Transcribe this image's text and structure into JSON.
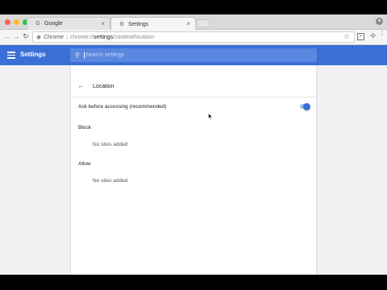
{
  "colors": {
    "accent": "#3b6fd6",
    "traffic_red": "#fc5f57",
    "traffic_yellow": "#fdbc2e",
    "traffic_green": "#28c840"
  },
  "tabs": [
    {
      "label": "Google",
      "icon": "google-favicon",
      "active": false
    },
    {
      "label": "Settings",
      "icon": "gear-icon",
      "active": true
    }
  ],
  "omnibox": {
    "site_label": "Chrome",
    "url_scheme": "chrome://",
    "url_host": "settings",
    "url_path": "/content/location"
  },
  "header": {
    "title": "Settings",
    "search_placeholder": "Search settings"
  },
  "page": {
    "title": "Location",
    "ask_label": "Ask before accessing (recommended)",
    "ask_enabled": true,
    "block_heading": "Block",
    "block_empty": "No sites added",
    "allow_heading": "Allow",
    "allow_empty": "No sites added"
  }
}
